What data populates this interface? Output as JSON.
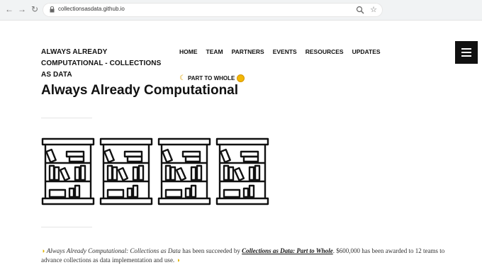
{
  "browser": {
    "url": "collectionsasdata.github.io",
    "back_glyph": "←",
    "forward_glyph": "→",
    "reload_glyph": "↻",
    "star_glyph": "☆"
  },
  "header": {
    "site_title": "ALWAYS ALREADY COMPUTATIONAL - COLLECTIONS AS DATA",
    "nav": [
      "HOME",
      "TEAM",
      "PARTNERS",
      "EVENTS",
      "RESOURCES",
      "UPDATES"
    ],
    "part_to_whole": "PART TO WHOLE"
  },
  "main": {
    "page_title": "Always Already Computational",
    "intro_parts": {
      "lead": "Always Already Computational: Collections as Data",
      "mid": " has been succeeded by ",
      "link": "Collections as Data: Part to Whole",
      "tail": ". $600,000 has been awarded to 12 teams to advance collections as data implementation and use."
    }
  },
  "icons": {
    "lock": "lock-icon",
    "zoom": "zoom-icon",
    "star": "star-icon",
    "menu": "hamburger-menu-icon",
    "moon": "moon-icon",
    "sun": "sun-icon",
    "bulb": "lightbulb-icon",
    "shelf": "bookshelf-icon"
  },
  "colors": {
    "accent_dark": "#111111",
    "highlight": "#f2b705"
  }
}
